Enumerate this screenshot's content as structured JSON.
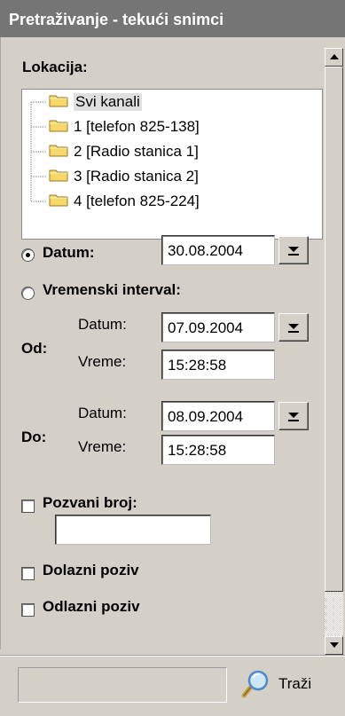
{
  "window": {
    "title": "Pretraživanje - tekući snimci"
  },
  "location": {
    "label": "Lokacija:",
    "items": [
      {
        "label": "Svi kanali",
        "selected": true
      },
      {
        "label": "1 [telefon 825-138]"
      },
      {
        "label": "2 [Radio stanica 1]"
      },
      {
        "label": "3 [Radio stanica 2]"
      },
      {
        "label": "4 [telefon 825-224]"
      }
    ]
  },
  "date_mode": {
    "label": "Datum:",
    "checked": true,
    "value": "30.08.2004"
  },
  "interval_mode": {
    "label": "Vremenski interval:",
    "checked": false,
    "from": {
      "label": "Od:",
      "date_label": "Datum:",
      "date": "07.09.2004",
      "time_label": "Vreme:",
      "time": "15:28:58"
    },
    "to": {
      "label": "Do:",
      "date_label": "Datum:",
      "date": "08.09.2004",
      "time_label": "Vreme:",
      "time": "15:28:58"
    }
  },
  "called_number": {
    "label": "Pozvani broj:",
    "checked": false,
    "value": ""
  },
  "incoming": {
    "label": "Dolazni poziv",
    "checked": false
  },
  "outgoing": {
    "label": "Odlazni poziv",
    "checked": false
  },
  "footer": {
    "search_label": "Traži",
    "status": ""
  },
  "colors": {
    "title_bg": "#757575",
    "panel_bg": "#d4d0c8",
    "folder": "#f5d76a"
  },
  "icons": {
    "folder": "folder-icon",
    "dropdown": "chevron-down-icon",
    "search": "magnifier-icon"
  }
}
